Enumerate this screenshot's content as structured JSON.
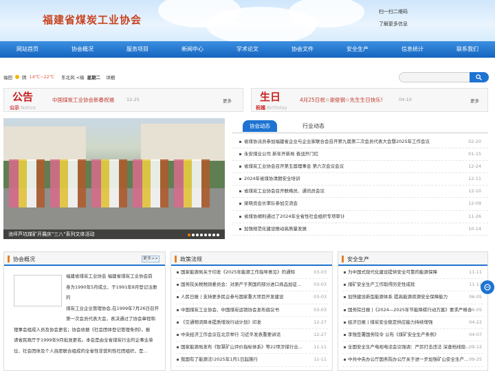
{
  "header": {
    "title": "福建省煤炭工业协会",
    "qr_text": "扫一扫二维码",
    "more_info": "了解更多信息"
  },
  "nav": [
    "网站首页",
    "协会概况",
    "服务项目",
    "新闻中心",
    "学术论文",
    "协会文件",
    "安全生产",
    "信息统计",
    "联系我们"
  ],
  "weather": {
    "city": "福田",
    "condition": "阴",
    "temp": "14℃~22℃",
    "wind": "东北风 <级",
    "weekday": "星期二",
    "detail": "详细"
  },
  "notice": {
    "char": "公告",
    "sub": "公示",
    "en": "Notice",
    "text": "中国煤炭工业协会新春祝福",
    "date": "12-25",
    "more": "更多"
  },
  "birthday": {
    "char": "生日",
    "sub": "祝福",
    "en": "Birthday",
    "text": "4月25日祝☆谢俊钢☆先生生日快乐!",
    "date": "04-10",
    "more": "更多"
  },
  "slide": {
    "caption": "池坪芦坑煤矿开展庆\"三八\"系列文体活动",
    "dot_count": 8,
    "active_dot": 0
  },
  "news": {
    "tab_active": "协会动态",
    "tab_other": "行业动态",
    "items": [
      {
        "title": "省煤协派员参加福建省企业与企业家联合会召开第九届第二次会员代表大会暨2025年工作会议",
        "date": "02-20"
      },
      {
        "title": "永安煤业公司 新年开新局 奋战开门红",
        "date": "01-15"
      },
      {
        "title": "省煤炭工业协会召开第五届理事会 第六次会议会议",
        "date": "12-24"
      },
      {
        "title": "2024年省煤协清朗安全培训",
        "date": "12-11"
      },
      {
        "title": "省煤炭工业协会召开联络员、通讯员会议",
        "date": "12-10"
      },
      {
        "title": "梁晓良会长率队参加交流会",
        "date": "12-09"
      },
      {
        "title": "省煤协顺利通过了2024年全省性社会组织专项审计",
        "date": "11-26"
      },
      {
        "title": "加强规范化建设推动高质量发展",
        "date": "10-14"
      }
    ]
  },
  "panel_overview": {
    "title": "协会概况",
    "more": "更多>>",
    "lines": [
      "福建省煤炭工业协会  福建省煤炭工业协会前",
      "身为1990年5月成立、于1991年8月登记注册的",
      "煤炭工业企业管理协会,在1999年7月26日召开",
      "第一次会员代表大会，表决通过了协会章程和",
      "理事会组成人员及协会更名；协会依据《社会团体登记管理条例》，报",
      "请省民政厅于1999年9月批准更名。本会是由全省煤炭行业的企事业单",
      "位、社会团体及个人自愿联合组成的全省性非营利性社团组织，是..."
    ]
  },
  "panel_policy": {
    "title": "政策法规",
    "items": [
      {
        "title": "国家能源局关于印发《2025年能源工作指导意见》的通知",
        "date": "03-03"
      },
      {
        "title": "国务院关税税则委员会：对原产于美国的部分进口商品加征...",
        "date": "03-03"
      },
      {
        "title": "人民日报丨支持更多民企参与国家重大项目开发建设",
        "date": "03-03"
      },
      {
        "title": "中国煤炭工业协会、中国煤炭运销协会发布倡议书",
        "date": "03-03"
      },
      {
        "title": "《交通物流降本提质增效行动计划》印发",
        "date": "12-27"
      },
      {
        "title": "中央经济工作会议在北京举行 习近平发表重要讲话",
        "date": "12-27"
      },
      {
        "title": "国家能源局发布《智慧矿山评价指标体系》等22项涉煤行业...",
        "date": "11-11"
      },
      {
        "title": "我国有了能源法!2025年1月1日起施行",
        "date": "11-11"
      }
    ]
  },
  "panel_safety": {
    "title": "安全生产",
    "items": [
      {
        "title": "为中国式现代化建设提供安全可靠的能源保障",
        "date": "11-11"
      },
      {
        "title": "煤矿安全生产工作取得历史性成就",
        "date": "11-11"
      },
      {
        "title": "加快建设新型能源体系 提高能源资源安全保障能力",
        "date": "06-05"
      },
      {
        "title": "国务院日报 |《2024—2025年节能降碳行动方案》要求严格合...",
        "date": "06-05"
      },
      {
        "title": "经济日报 | 煤炭安全稳定供应能力持续增强",
        "date": "04-22"
      },
      {
        "title": "李强签署国务院令 公布《煤矿安全生产条例》",
        "date": "04-07"
      },
      {
        "title": "全国安全生产电视电话会议强调：严厉打击违法 深查档线隐...",
        "date": "09-12"
      },
      {
        "title": "中共中央办公厅国务院办公厅关于进一步加强矿山安全生产...",
        "date": "09-25"
      }
    ]
  },
  "colors": {
    "nav_blue": "#1e73d2",
    "title_red": "#c8431f",
    "accent_orange": "#e67e22"
  }
}
